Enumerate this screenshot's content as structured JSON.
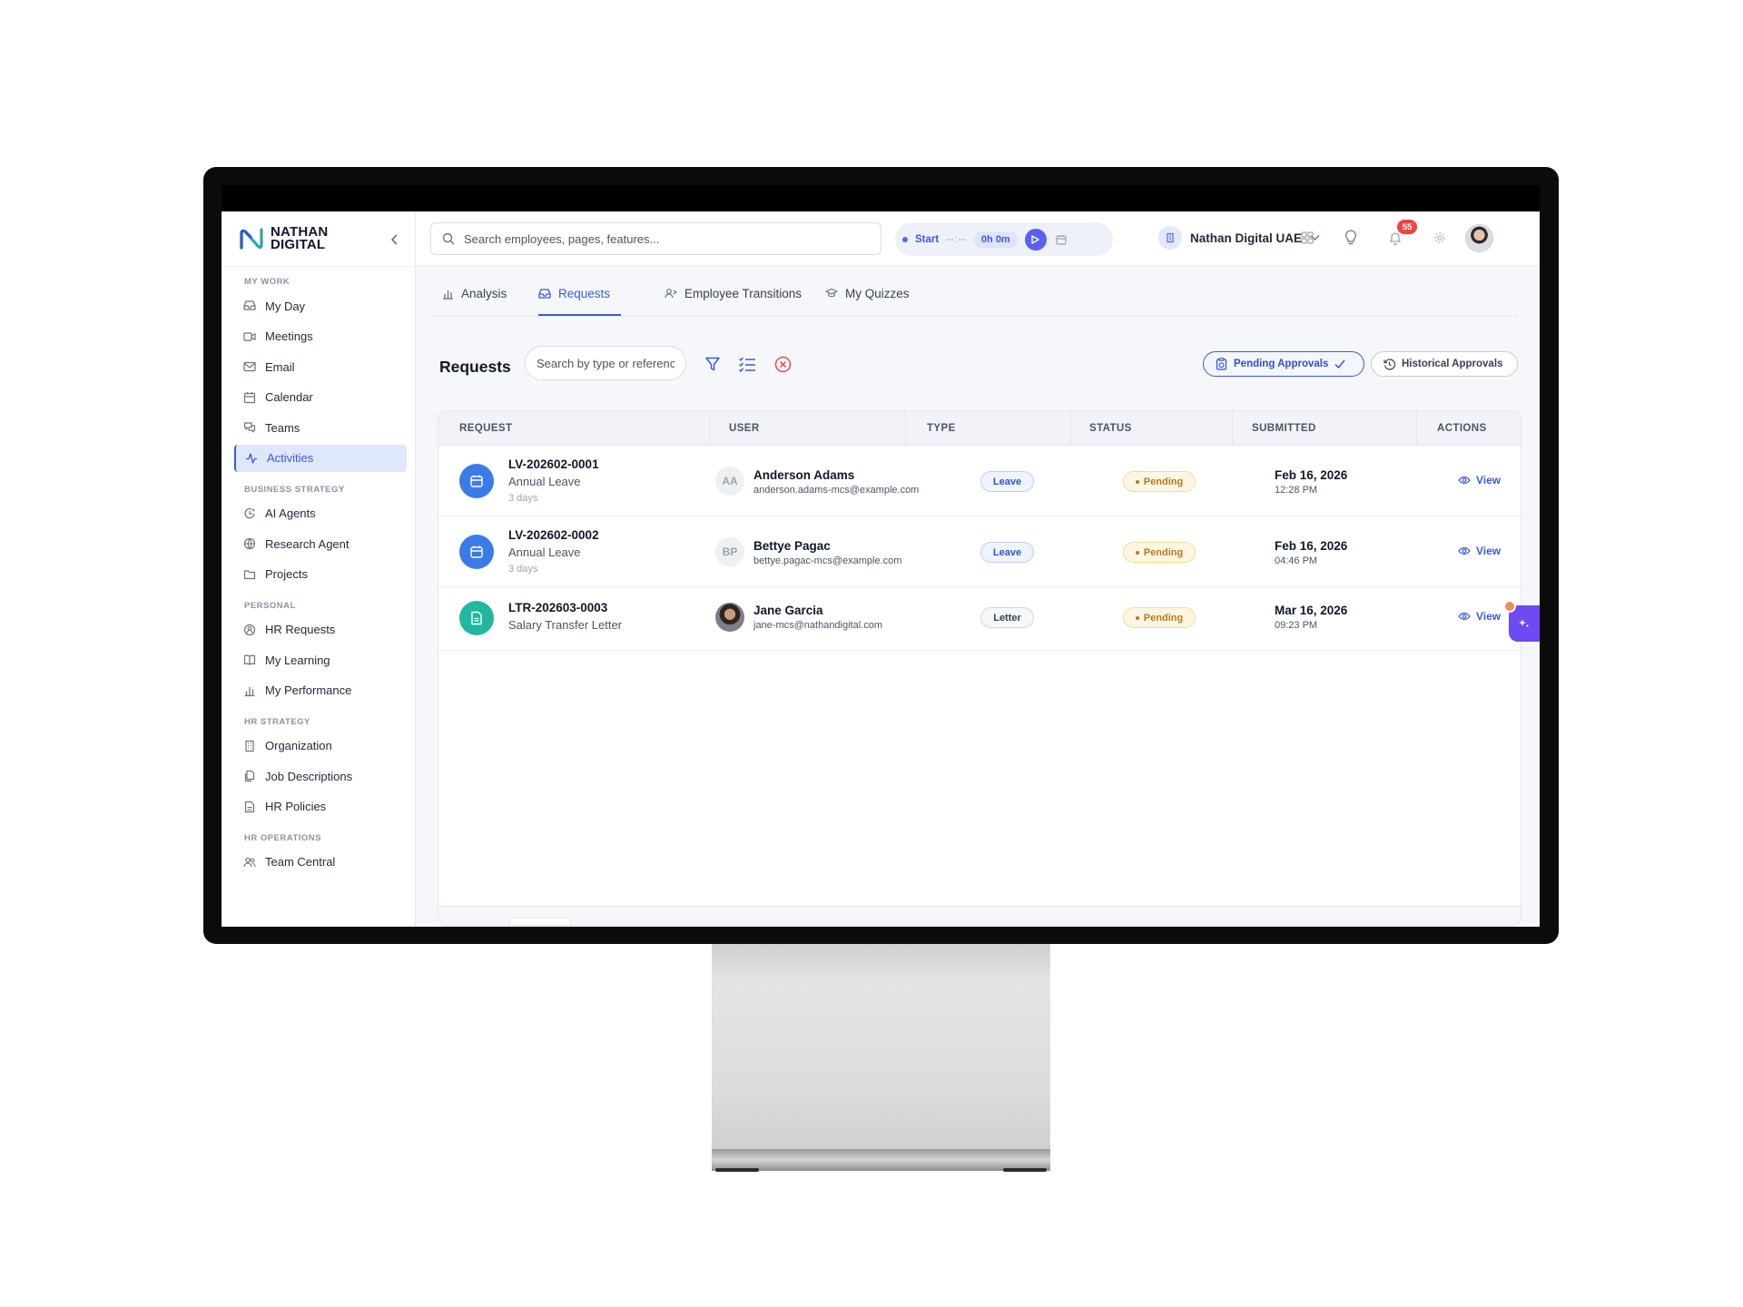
{
  "app": {
    "brand_line1": "NATHAN",
    "brand_line2": "DIGITAL"
  },
  "sidebar": {
    "sections": [
      {
        "title": "MY WORK",
        "items": [
          {
            "label": "My Day",
            "icon": "inbox-icon"
          },
          {
            "label": "Meetings",
            "icon": "video-icon"
          },
          {
            "label": "Email",
            "icon": "mail-icon"
          },
          {
            "label": "Calendar",
            "icon": "calendar-icon"
          },
          {
            "label": "Teams",
            "icon": "chat-icon"
          },
          {
            "label": "Activities",
            "icon": "activity-icon",
            "active": true
          }
        ]
      },
      {
        "title": "BUSINESS STRATEGY",
        "items": [
          {
            "label": "AI Agents",
            "icon": "agent-icon"
          },
          {
            "label": "Research Agent",
            "icon": "globe-icon"
          },
          {
            "label": "Projects",
            "icon": "folder-icon"
          }
        ]
      },
      {
        "title": "PERSONAL",
        "items": [
          {
            "label": "HR Requests",
            "icon": "hr-icon"
          },
          {
            "label": "My Learning",
            "icon": "book-icon"
          },
          {
            "label": "My Performance",
            "icon": "bar-chart-icon"
          }
        ]
      },
      {
        "title": "HR STRATEGY",
        "items": [
          {
            "label": "Organization",
            "icon": "building-icon"
          },
          {
            "label": "Job Descriptions",
            "icon": "documents-icon"
          },
          {
            "label": "HR Policies",
            "icon": "file-icon"
          }
        ]
      },
      {
        "title": "HR OPERATIONS",
        "items": [
          {
            "label": "Team Central",
            "icon": "users-icon"
          }
        ]
      }
    ]
  },
  "header": {
    "search_placeholder": "Search employees, pages, features...",
    "timer": {
      "start_label": "Start",
      "time": "--:--",
      "duration": "0h 0m"
    },
    "org_name": "Nathan Digital UAE",
    "notification_count": "55"
  },
  "tabs": [
    {
      "label": "Analysis",
      "icon": "bar-chart-icon"
    },
    {
      "label": "Requests",
      "icon": "inbox-icon",
      "active": true
    },
    {
      "label": "Employee Transitions",
      "icon": "transition-icon"
    },
    {
      "label": "My Quizzes",
      "icon": "graduation-cap-icon"
    }
  ],
  "requests": {
    "title": "Requests",
    "search_placeholder": "Search by type or reference...",
    "pending_approvals_label": "Pending Approvals",
    "historical_approvals_label": "Historical Approvals",
    "columns": [
      "REQUEST",
      "USER",
      "TYPE",
      "STATUS",
      "SUBMITTED",
      "ACTIONS"
    ],
    "rows": [
      {
        "id": "LV-202602-0001",
        "request_type": "Annual Leave",
        "age": "3 days",
        "icon": "calendar-icon",
        "icon_color": "#3b7be8",
        "user_initials": "AA",
        "user_name": "Anderson Adams",
        "user_email": "anderson.adams-mcs@example.com",
        "type": "Leave",
        "status": "Pending",
        "date": "Feb 16, 2026",
        "time": "12:28 PM",
        "action": "View"
      },
      {
        "id": "LV-202602-0002",
        "request_type": "Annual Leave",
        "age": "3 days",
        "icon": "calendar-icon",
        "icon_color": "#3b7be8",
        "user_initials": "BP",
        "user_name": "Bettye Pagac",
        "user_email": "bettye.pagac-mcs@example.com",
        "type": "Leave",
        "status": "Pending",
        "date": "Feb 16, 2026",
        "time": "04:46 PM",
        "action": "View"
      },
      {
        "id": "LTR-202603-0003",
        "request_type": "Salary Transfer Letter",
        "age": "",
        "icon": "document-icon",
        "icon_color": "#22b8a0",
        "user_initials": "",
        "user_name": "Jane Garcia",
        "user_email": "jane-mcs@nathandigital.com",
        "type": "Letter",
        "status": "Pending",
        "date": "Mar 16, 2026",
        "time": "09:23 PM",
        "action": "View"
      }
    ]
  },
  "colors": {
    "accent": "#3b5bdb",
    "pending": "#b7791f",
    "assistant": "#6d4af2",
    "badge": "#ef4444"
  }
}
